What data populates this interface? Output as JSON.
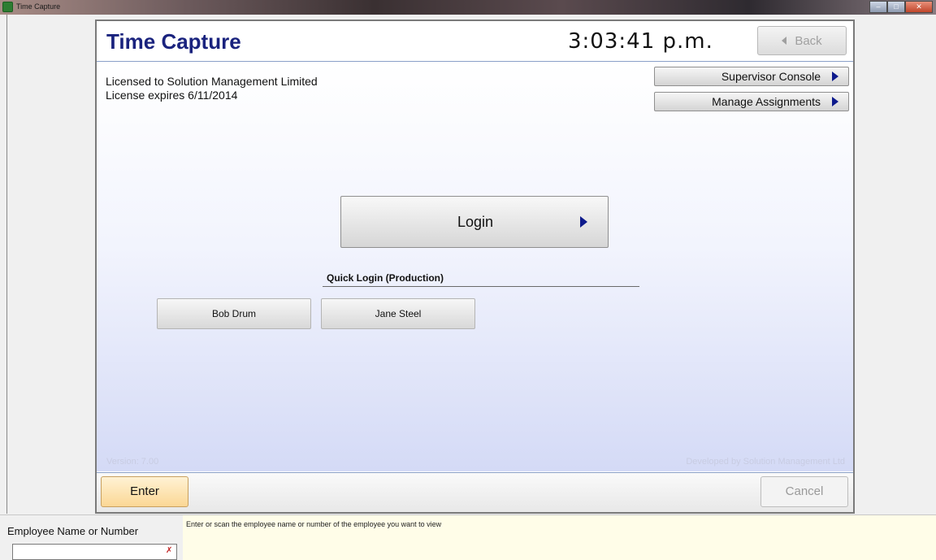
{
  "window": {
    "title": "Time Capture",
    "controls": [
      "minimize",
      "maximize",
      "close"
    ]
  },
  "header": {
    "app_title": "Time Capture",
    "clock": "3:03:41 p.m.",
    "back_label": "Back"
  },
  "license": {
    "line1": "Licensed to Solution Management Limited",
    "line2": "License expires 6/11/2014"
  },
  "side_buttons": {
    "supervisor_console": "Supervisor Console",
    "manage_assignments": "Manage Assignments"
  },
  "login": {
    "label": "Login"
  },
  "quick_login": {
    "title": "Quick Login (Production)",
    "users": [
      "Bob Drum",
      "Jane Steel"
    ]
  },
  "footer_info": {
    "version": "Version: 7.00",
    "developer": "Developed by Solution Management Ltd"
  },
  "footer": {
    "enter_label": "Enter",
    "cancel_label": "Cancel"
  },
  "employee": {
    "label": "Employee Name or Number",
    "value": "",
    "hint": "Enter or scan the employee name or number of the employee you want to view"
  },
  "colors": {
    "title_blue": "#1a237e",
    "enter_orange": "#fbd795",
    "hint_yellow": "#fffde8"
  }
}
